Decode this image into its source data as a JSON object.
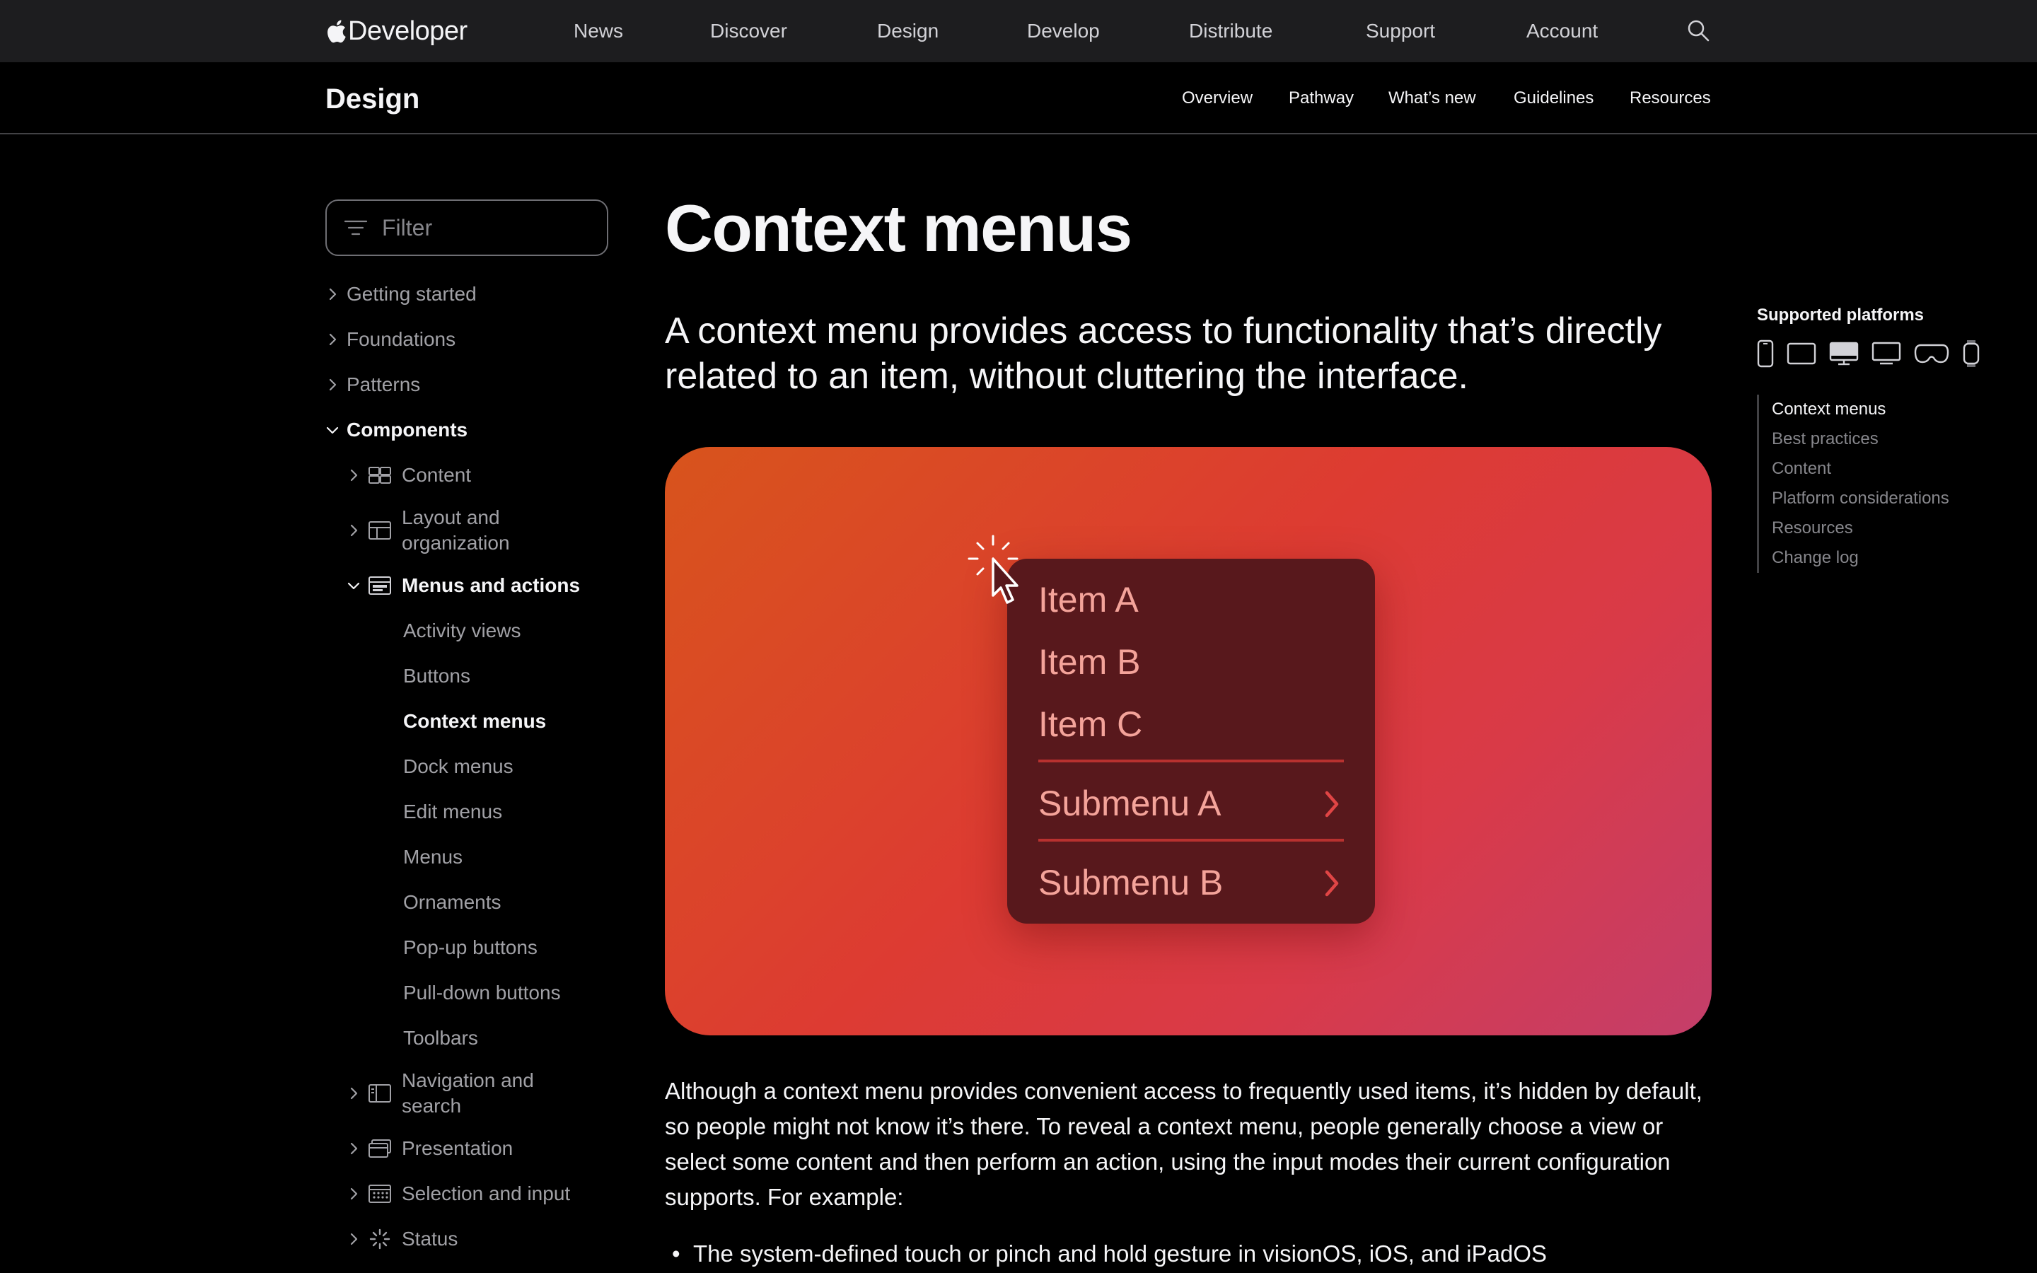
{
  "globalnav": {
    "logo_text": "Developer",
    "links": [
      "News",
      "Discover",
      "Design",
      "Develop",
      "Distribute",
      "Support",
      "Account"
    ]
  },
  "localnav": {
    "title": "Design",
    "links": [
      "Overview",
      "Pathway",
      "What’s new",
      "Guidelines",
      "Resources"
    ]
  },
  "sidebar": {
    "filter_placeholder": "Filter",
    "sections": [
      "Getting started",
      "Foundations",
      "Patterns",
      "Components"
    ],
    "categories": {
      "content": "Content",
      "layout": [
        "Layout and",
        "organization"
      ],
      "menus": "Menus and actions",
      "navigation": [
        "Navigation and",
        "search"
      ],
      "presentation": "Presentation",
      "selection": "Selection and input",
      "status": "Status"
    },
    "menu_items": [
      "Activity views",
      "Buttons",
      "Context menus",
      "Dock menus",
      "Edit menus",
      "Menus",
      "Ornaments",
      "Pop-up buttons",
      "Pull-down buttons",
      "Toolbars"
    ]
  },
  "main": {
    "title": "Context menus",
    "intro": "A context menu provides access to functionality that’s directly related to an item, without cluttering the interface.",
    "hero_menu": {
      "items": [
        "Item A",
        "Item B",
        "Item C"
      ],
      "submenus": [
        "Submenu A",
        "Submenu B"
      ]
    },
    "body": "Although a context menu provides convenient access to frequently used items, it’s hidden by default, so people might not know it’s there. To reveal a context menu, people generally choose a view or select some content and then perform an action, using the input modes their current configuration supports. For example:",
    "bullets": [
      "The system-defined touch or pinch and hold gesture in visionOS, iOS, and iPadOS"
    ]
  },
  "rail": {
    "supported_title": "Supported platforms",
    "platform_icons": [
      "iphone-icon",
      "ipad-icon",
      "mac-icon",
      "tv-icon",
      "vision-pro-icon",
      "watch-icon"
    ],
    "toc": [
      "Context menus",
      "Best practices",
      "Content",
      "Platform considerations",
      "Resources",
      "Change log"
    ]
  },
  "colors": {
    "hero_gradient_start": "#d8541c",
    "hero_gradient_end": "#c43e6a",
    "menu_bg": "#58181c",
    "menu_text": "#f4a39a",
    "menu_separator": "#b8312f"
  }
}
